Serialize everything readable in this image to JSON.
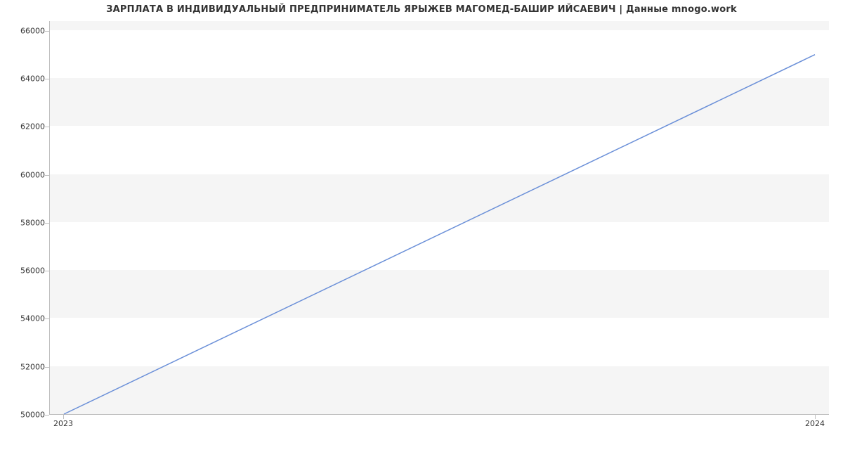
{
  "chart_data": {
    "type": "line",
    "title": "ЗАРПЛАТА В ИНДИВИДУАЛЬНЫЙ ПРЕДПРИНИМАТЕЛЬ ЯРЫЖЕВ МАГОМЕД-БАШИР ИЙСАЕВИЧ | Данные mnogo.work",
    "xlabel": "",
    "ylabel": "",
    "x": [
      2023,
      2024
    ],
    "values": [
      50000,
      65000
    ],
    "xticks": [
      2023,
      2024
    ],
    "yticks": [
      50000,
      52000,
      54000,
      56000,
      58000,
      60000,
      62000,
      64000,
      66000
    ],
    "xlim": [
      2023,
      2024
    ],
    "ylim": [
      50000,
      66400
    ],
    "line_color": "#6a8fd8",
    "panel_color": "#f5f5f5"
  }
}
